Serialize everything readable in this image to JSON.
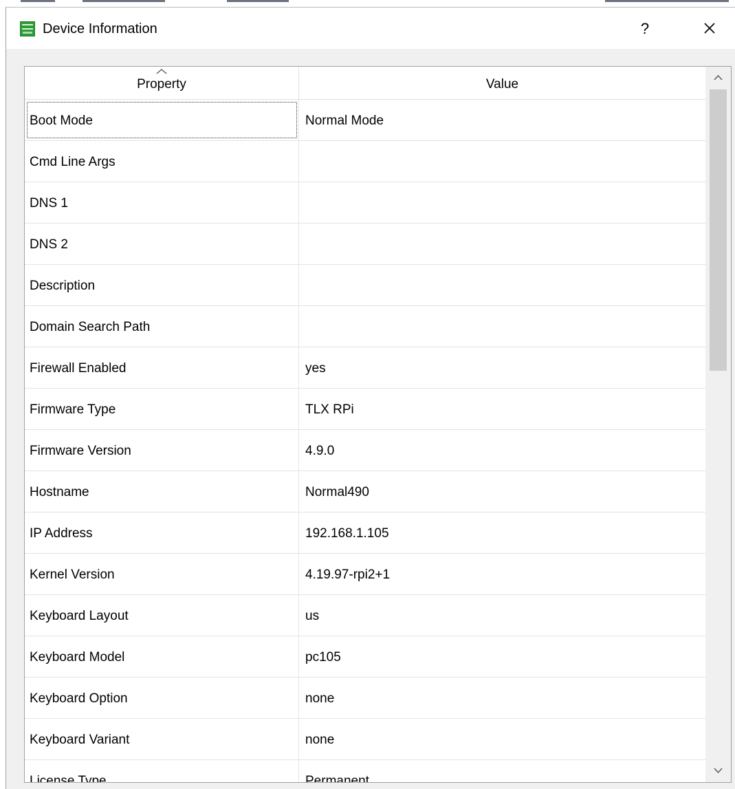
{
  "window": {
    "title": "Device Information",
    "help_label": "?",
    "icon": "tms-app-icon"
  },
  "table": {
    "columns": [
      "Property",
      "Value"
    ],
    "sort_indicator": "chevron-up-icon",
    "rows": [
      {
        "property": "Boot Mode",
        "value": "Normal Mode"
      },
      {
        "property": "Cmd Line Args",
        "value": ""
      },
      {
        "property": "DNS 1",
        "value": ""
      },
      {
        "property": "DNS 2",
        "value": ""
      },
      {
        "property": "Description",
        "value": ""
      },
      {
        "property": "Domain Search Path",
        "value": ""
      },
      {
        "property": "Firewall Enabled",
        "value": "yes"
      },
      {
        "property": "Firmware Type",
        "value": "TLX RPi"
      },
      {
        "property": "Firmware Version",
        "value": "4.9.0"
      },
      {
        "property": "Hostname",
        "value": "Normal490"
      },
      {
        "property": "IP Address",
        "value": "192.168.1.105"
      },
      {
        "property": "Kernel Version",
        "value": "4.19.97-rpi2+1"
      },
      {
        "property": "Keyboard Layout",
        "value": "us"
      },
      {
        "property": "Keyboard Model",
        "value": "pc105"
      },
      {
        "property": "Keyboard Option",
        "value": "none"
      },
      {
        "property": "Keyboard Variant",
        "value": "none"
      },
      {
        "property": "License Type",
        "value": "Permanent"
      }
    ]
  },
  "scrollbar": {
    "position_fraction": 0.0,
    "visible_fraction": 0.42
  }
}
